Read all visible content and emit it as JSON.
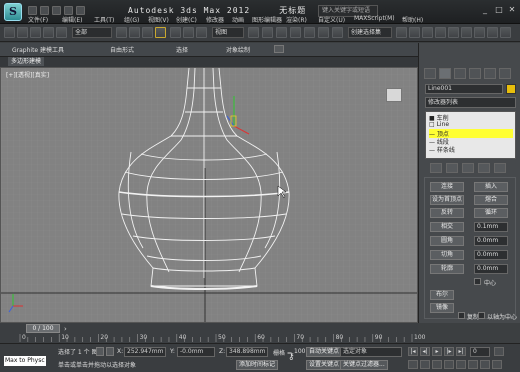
{
  "app": {
    "title": "Autodesk 3ds Max  2012",
    "file": "无标题",
    "search_placeholder": "键入关键字或短语",
    "minimize": "_",
    "maximize": "□",
    "close": "✕"
  },
  "menu": {
    "items": [
      "文件(F)",
      "编辑(E)",
      "工具(T)",
      "组(G)",
      "视图(V)",
      "创建(C)",
      "修改器",
      "动画",
      "图形编辑器",
      "渲染(R)",
      "自定义(U)",
      "MAXScript(M)",
      "帮助(H)"
    ]
  },
  "toolbar": {
    "selection_filter": "全部",
    "ref_coord": "视图",
    "named_set": "创建选择集"
  },
  "ribbon": {
    "tabs": [
      "Graphite 建模工具",
      "自由形式",
      "选择",
      "对象绘制"
    ],
    "subpanel": "多边形建模"
  },
  "viewport": {
    "label": "[+][透视][真实]"
  },
  "command_panel": {
    "object_name": "Line001",
    "object_color": "#e8be0c",
    "modifier_list": "修改器列表",
    "stack": [
      {
        "label": "■ 车削",
        "highlight": false
      },
      {
        "label": "□ Line",
        "highlight": false
      },
      {
        "label": "— 顶点",
        "highlight": true
      },
      {
        "label": "— 线段",
        "highlight": false
      },
      {
        "label": "— 样条线",
        "highlight": false
      }
    ],
    "buttons": {
      "row1": [
        "连接",
        "插入"
      ],
      "row2": [
        "设为首顶点",
        "熔合"
      ],
      "row3": [
        "反转",
        "循环"
      ],
      "row4_label": "相交",
      "row4_val": "0.1mm",
      "row5_btn": "圆角",
      "row5_val": "0.0mm",
      "row6_btn": "切角",
      "row6_val": "0.0mm",
      "row7_btn": "轮廓",
      "row7_val": "0.0mm",
      "center": "中心",
      "boolean": "布尔",
      "mirror": "镜像",
      "copy": "复制",
      "axis": "以轴为中心",
      "trim": "修剪",
      "extend": "延伸",
      "infinite": "无限边界"
    }
  },
  "timeline": {
    "frame": "0 / 100",
    "ticks": [
      "0",
      "10",
      "20",
      "30",
      "40",
      "50",
      "60",
      "70",
      "80",
      "90",
      "100"
    ]
  },
  "status": {
    "maxscript": "Max to Physc",
    "selected": "选择了 1 个 图形",
    "prompt": "单击或单击并拖动以选择对象",
    "x_label": "X:",
    "x_val": "252.947mm",
    "y_label": "Y:",
    "y_val": "-0.0mm",
    "z_label": "Z:",
    "z_val": "348.898mm",
    "grid_label": "栅格 =",
    "grid_val": "100.0mm",
    "add_key": "添加时间标记",
    "auto_key": "自动关键点",
    "selected_obj": "选定对象",
    "set_key": "设置关键点",
    "key_filter": "关键点过滤器...",
    "frame_field": "0"
  }
}
